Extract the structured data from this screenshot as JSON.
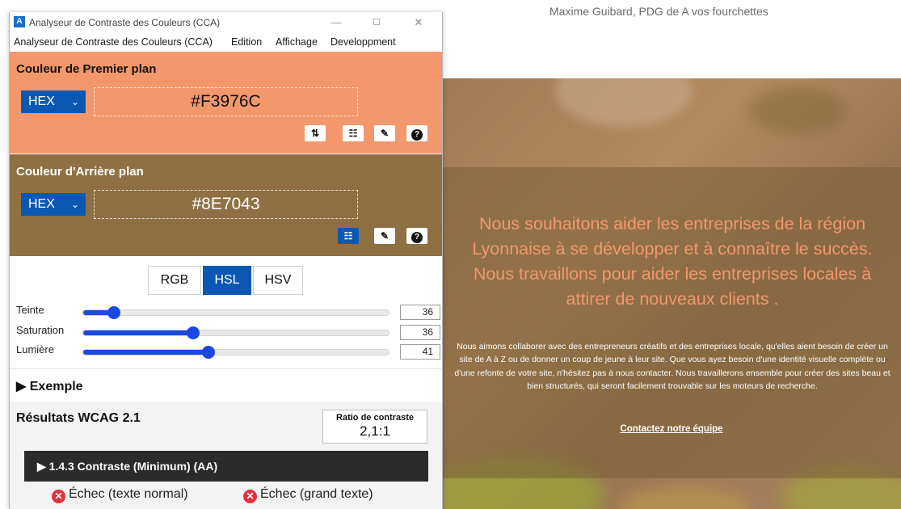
{
  "website": {
    "quote_author": "Maxime Guibard, PDG de A vos fourchettes",
    "heading": "Nous souhaitons aider les entreprises de la région Lyonnaise à se développer et à connaître le succès. Nous travaillons pour aider les entreprises locales à attirer de nouveaux clients .",
    "body": "Nous aimons collaborer avec des entrepreneurs créatifs et des entreprises locale, qu'elles aient besoin de créer un site de A à Z ou de donner un coup de jeune à leur site. Que vous ayez besoin d'une identité visuelle complète ou d'une refonte de votre site, n'hésitez pas à nous contacter. Nous travaillerons ensemble pour créer des sites beau et bien structurés, qui seront facilement trouvable sur les moteurs de recherche.",
    "cta_label": "Contactez notre équipe",
    "heading_color": "#F3976C"
  },
  "window": {
    "title": "Analyseur de Contraste des Couleurs (CCA)",
    "icon": "app-icon",
    "controls": {
      "minimize": "—",
      "maximize": "☐",
      "close": "✕"
    }
  },
  "menu": {
    "items": [
      "Analyseur de Contraste des Couleurs (CCA)",
      "Edition",
      "Affichage",
      "Developpment"
    ]
  },
  "foreground": {
    "title": "Couleur de Premier plan",
    "format": "HEX",
    "value": "#F3976C",
    "color": "#F3976C",
    "tools": {
      "swap": "⇅",
      "sliders": "☷",
      "picker": "✎",
      "help": "?"
    }
  },
  "background": {
    "title": "Couleur d'Arrière plan",
    "format": "HEX",
    "value": "#8E7043",
    "color": "#8E7043",
    "tools": {
      "sliders": "☷",
      "picker": "✎",
      "help": "?"
    }
  },
  "modes": {
    "rgb": "RGB",
    "hsl": "HSL",
    "hsv": "HSV",
    "active": "HSL"
  },
  "sliders": [
    {
      "label": "Teinte",
      "value": "36",
      "fraction": 0.1
    },
    {
      "label": "Saturation",
      "value": "36",
      "fraction": 0.36
    },
    {
      "label": "Lumière",
      "value": "41",
      "fraction": 0.41
    }
  ],
  "example": {
    "label": "▶ Exemple"
  },
  "results": {
    "title": "Résultats WCAG 2.1",
    "ratio_label": "Ratio de contraste",
    "ratio_value": "2,1:1",
    "criterion": "▶ 1.4.3 Contraste (Minimum) (AA)",
    "normal_text": "Échec (texte normal)",
    "large_text": "Échec (grand texte)",
    "fail_color": "#e0323e"
  },
  "accent_color": "#0a58b4",
  "slider_color": "#1a49e0"
}
